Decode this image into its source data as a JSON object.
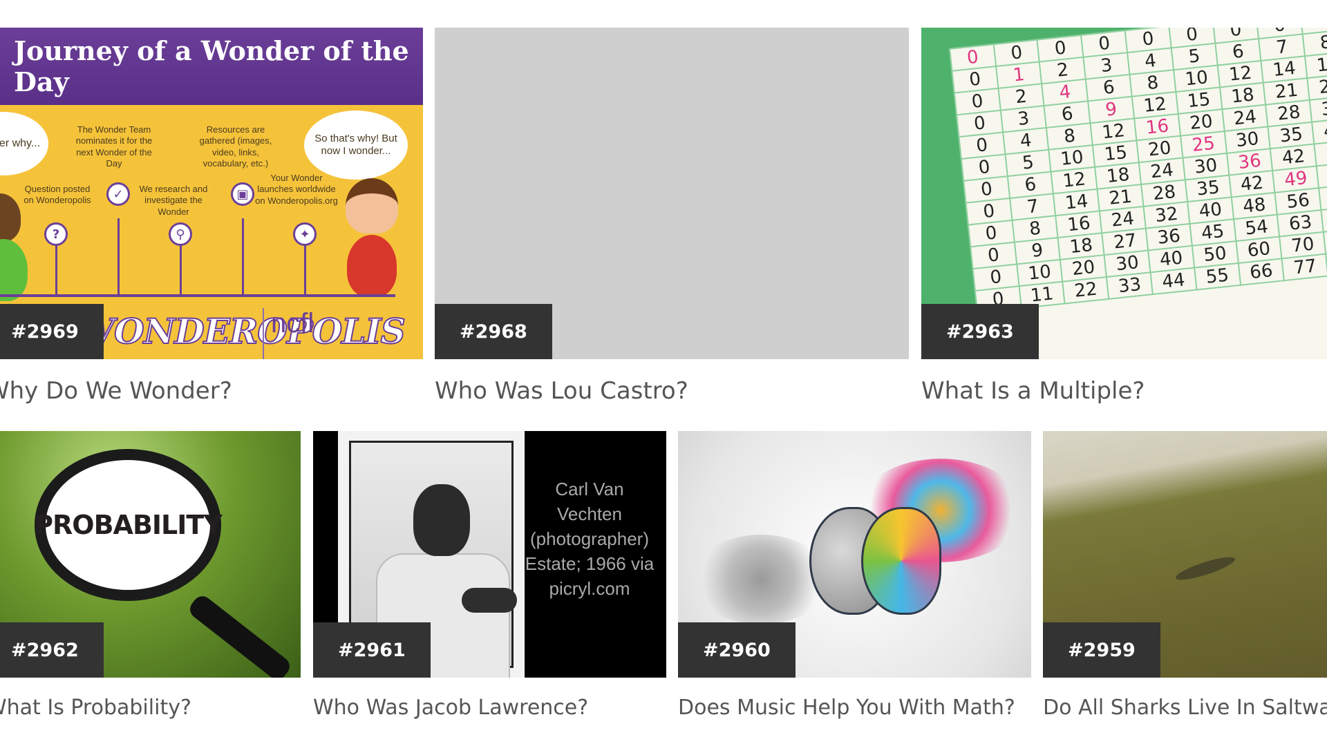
{
  "cards": [
    {
      "badge": "#2969",
      "title": "Why Do We Wonder?",
      "image": {
        "heading": "Journey of a Wonder of the Day",
        "bubble_left": "I wonder why...",
        "bubble_right": "So that's why! But now I wonder...",
        "steps": [
          "Question posted on Wonderopolis",
          "The Wonder Team nominates it for the next Wonder of the Day",
          "We research and investigate the Wonder",
          "Resources are gathered (images, video, links, vocabulary, etc.)",
          "Your Wonder launches worldwide on Wonderopolis.org"
        ],
        "logo": "WONDEROPOLIS",
        "logo2": "ncfl"
      }
    },
    {
      "badge": "#2968",
      "title": "Who Was Lou Castro?"
    },
    {
      "badge": "#2963",
      "title": "What Is a Multiple?"
    },
    {
      "badge": "#2962",
      "title": "What Is Probability?",
      "image": {
        "text": "PROBABILITY"
      }
    },
    {
      "badge": "#2961",
      "title": "Who Was Jacob Lawrence?",
      "image": {
        "credit": "Carl Van Vechten (photographer) Estate; 1966 via picryl.com"
      }
    },
    {
      "badge": "#2960",
      "title": "Does Music Help You With Math?"
    },
    {
      "badge": "#2959",
      "title": "Do All Sharks Live In Saltwater?"
    }
  ],
  "colors": {
    "badge_bg": "#333333",
    "title_text": "#555555",
    "accent_purple": "#6b3f98"
  }
}
